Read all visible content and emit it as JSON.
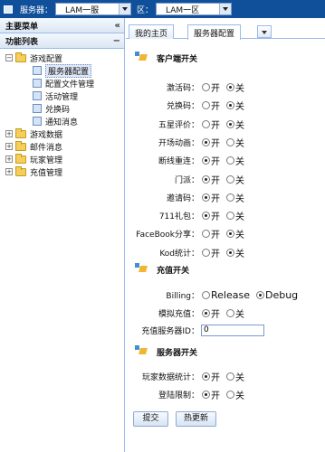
{
  "topbar": {
    "server_label": "服务器：",
    "server_value": "LAM一服",
    "zone_label": "区：",
    "zone_value": "LAM一区"
  },
  "sidebar": {
    "main_menu": "主要菜单",
    "collapse_glyph": "«",
    "func_list": "功能列表",
    "func_toggle": "−",
    "tree": [
      {
        "label": "游戏配置",
        "expanded": true,
        "children": [
          "服务器配置",
          "配置文件管理",
          "活动管理",
          "兑换码",
          "通知消息"
        ],
        "selected": "服务器配置"
      },
      {
        "label": "游戏数据",
        "expanded": false
      },
      {
        "label": "邮件消息",
        "expanded": false
      },
      {
        "label": "玩家管理",
        "expanded": false
      },
      {
        "label": "充值管理",
        "expanded": false
      }
    ]
  },
  "tabs": {
    "home": "我的主页",
    "server_config": "服务器配置"
  },
  "client": {
    "title": "客户端开关",
    "on": "开",
    "off": "关",
    "rows": [
      {
        "label": "激活码：",
        "value": "off"
      },
      {
        "label": "兑换码：",
        "value": "off"
      },
      {
        "label": "五星评价：",
        "value": "off"
      },
      {
        "label": "开场动画：",
        "value": "on"
      },
      {
        "label": "断线重连：",
        "value": "on"
      },
      {
        "label": "门派：",
        "value": "on"
      },
      {
        "label": "邀请码：",
        "value": "on"
      },
      {
        "label": "711礼包：",
        "value": "on"
      },
      {
        "label": "FaceBook分享：",
        "value": "off"
      },
      {
        "label": "Kod统计：",
        "value": "off"
      }
    ]
  },
  "recharge": {
    "title": "充值开关",
    "billing_label": "Billing：",
    "release": "Release",
    "debug": "Debug",
    "billing_value": "debug",
    "mock_label": "模拟充值：",
    "mock_value": "on",
    "server_id_label": "充值服务器ID：",
    "server_id_value": "0"
  },
  "serverside": {
    "title": "服务器开关",
    "rows": [
      {
        "label": "玩家数据统计：",
        "value": "on"
      },
      {
        "label": "登陆限制：",
        "value": "on"
      }
    ]
  },
  "buttons": {
    "submit": "提交",
    "refresh": "热更新"
  }
}
